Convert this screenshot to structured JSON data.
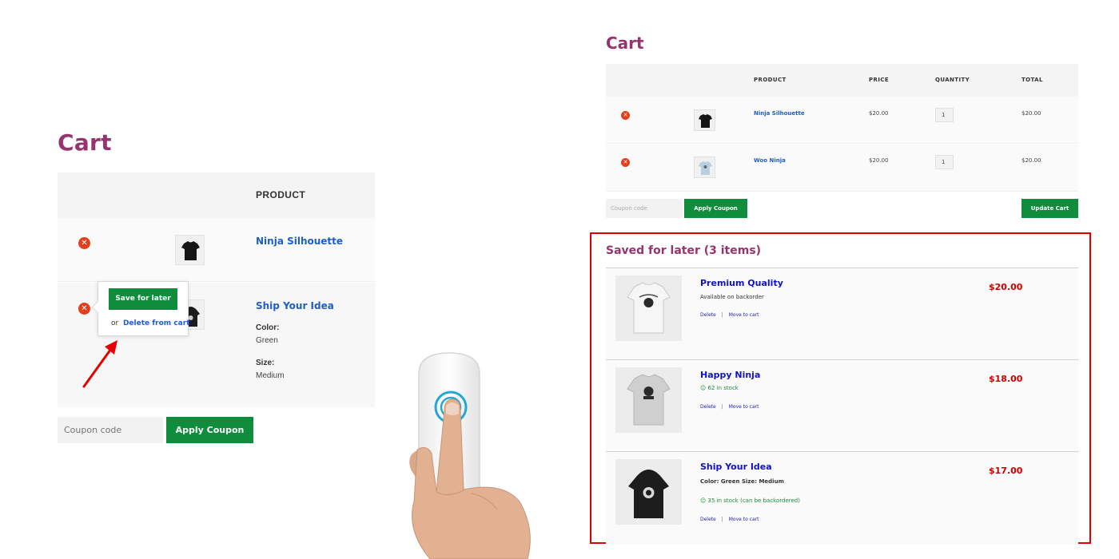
{
  "left_cart": {
    "title": "Cart",
    "column_product": "PRODUCT",
    "items": [
      {
        "name": "Ninja Silhouette",
        "remove_icon": "remove-circle-icon"
      },
      {
        "name": "Ship Your Idea",
        "color_label": "Color:",
        "color_value": "Green",
        "size_label": "Size:",
        "size_value": "Medium",
        "remove_icon": "remove-circle-icon"
      }
    ],
    "popup": {
      "save_label": "Save for later",
      "or_text": "or",
      "delete_label": "Delete from cart"
    },
    "coupon_placeholder": "Coupon code",
    "apply_coupon_label": "Apply Coupon"
  },
  "right_cart": {
    "title": "Cart",
    "columns": {
      "product": "PRODUCT",
      "price": "PRICE",
      "quantity": "QUANTITY",
      "total": "TOTAL"
    },
    "items": [
      {
        "name": "Ninja Silhouette",
        "price": "$20.00",
        "qty": "1",
        "total": "$20.00"
      },
      {
        "name": "Woo Ninja",
        "price": "$20.00",
        "qty": "1",
        "total": "$20.00"
      }
    ],
    "coupon_placeholder": "Coupon code",
    "apply_coupon_label": "Apply Coupon",
    "update_cart_label": "Update Cart"
  },
  "saved_for_later": {
    "title": "Saved for later (3 items)",
    "delete_label": "Delete",
    "separator": "|",
    "move_label": "Move to cart",
    "items": [
      {
        "name": "Premium Quality",
        "note": "Available on backorder",
        "price": "$20.00"
      },
      {
        "name": "Happy Ninja",
        "stock": "62 in stock",
        "price": "$18.00"
      },
      {
        "name": "Ship Your Idea",
        "variant": "Color: Green Size: Medium",
        "stock": "35 in stock (can be backordered)",
        "price": "$17.00"
      }
    ]
  },
  "colors": {
    "title_purple": "#96346f",
    "button_green": "#0f8d3c",
    "link_blue": "#1e5ec6",
    "price_red": "#d10000",
    "highlight_border": "#e00000"
  }
}
